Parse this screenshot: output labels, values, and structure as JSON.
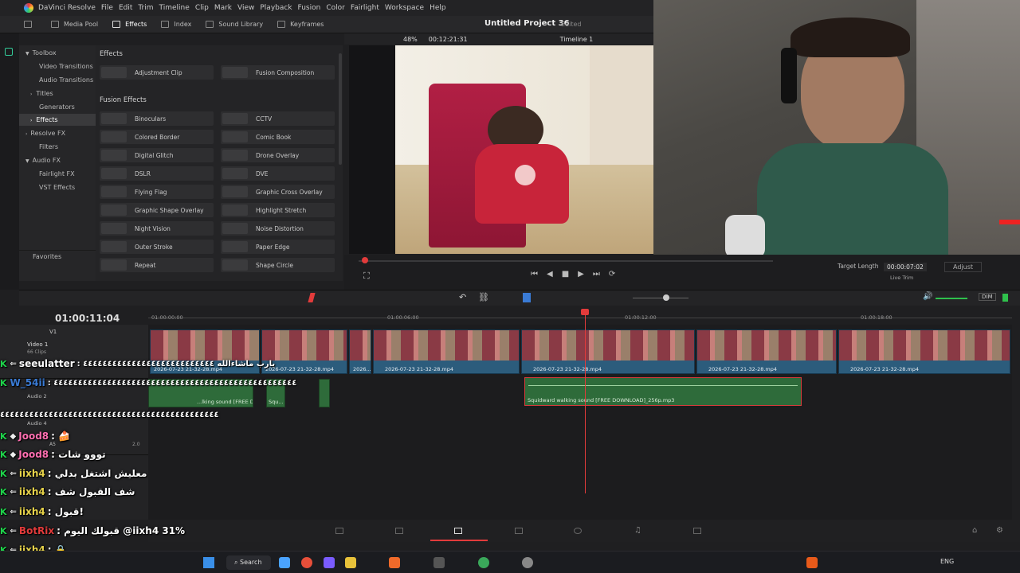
{
  "menu": {
    "app": "DaVinci Resolve",
    "items": [
      "File",
      "Edit",
      "Trim",
      "Timeline",
      "Clip",
      "Mark",
      "View",
      "Playback",
      "Fusion",
      "Color",
      "Fairlight",
      "Workspace",
      "Help"
    ]
  },
  "toolbar": {
    "media_pool": "Media Pool",
    "effects": "Effects",
    "index": "Index",
    "sound_library": "Sound Library",
    "keyframes": "Keyframes"
  },
  "project": {
    "title": "Untitled Project 36",
    "status": "Edited"
  },
  "viewer": {
    "zoom": "48%",
    "timecode": "00:12:21:31",
    "timeline_name": "Timeline 1"
  },
  "sidebar": {
    "items": [
      "Toolbox",
      "Video Transitions",
      "Audio Transitions",
      "Titles",
      "Generators",
      "Effects",
      "Resolve FX",
      "Filters",
      "Audio FX",
      "Fairlight FX",
      "VST Effects",
      "Favorites"
    ]
  },
  "effects": {
    "section1": "Effects",
    "section1_items": [
      "Adjustment Clip",
      "Fusion Composition"
    ],
    "section2": "Fusion Effects",
    "section2_items": [
      "Binoculars",
      "CCTV",
      "Colored Border",
      "Comic Book",
      "Digital Glitch",
      "Drone Overlay",
      "DSLR",
      "DVE",
      "Flying Flag",
      "Graphic Cross Overlay",
      "Graphic Shape Overlay",
      "Highlight Stretch",
      "Night Vision",
      "Noise Distortion",
      "Outer Stroke",
      "Paper Edge",
      "Repeat",
      "Shape Circle"
    ]
  },
  "transport": {
    "target_length_label": "Target Length",
    "target_length": "00:00:07:02",
    "live_trim": "Live Trim",
    "adjust": "Adjust",
    "dim": "DIM"
  },
  "timeline": {
    "current_timecode": "01:00:11:04",
    "ruler": [
      "01:00:00:00",
      "01:00:06:00",
      "01:00:12:00",
      "01:00:18:00"
    ],
    "video_track": {
      "name": "Video 1",
      "count": "66 Clips",
      "id": "V1"
    },
    "video_clips": [
      "2026-07-23 21-32-28.mp4",
      "2026-07-23 21-32-28.mp4",
      "2026...",
      "2026-07-23 21-32-28.mp4",
      "2026-07-23 21-32-28.mp4",
      "2026-07-23 21-32-28.mp4",
      "2026-07-23 21-32-28.mp4"
    ],
    "audio_track_2": "Audio 2",
    "audio_track_4": "Audio 4",
    "audio_track_4_id": "A5",
    "audio_level": "2.0",
    "audio_clips": [
      "...lking sound [FREE DOW...",
      "Squ...",
      "Squidward walking sound [FREE DOWNLOAD]_256p.mp3"
    ]
  },
  "chat": [
    {
      "user": "seeulatter",
      "msg": "يارب ماشاءالله ٤٤٤٤٤٤٤٤٤٤٤٤٤٤٤٤٤٤٤٤٤٤٤٤٤٤٤",
      "color": "#ffffff"
    },
    {
      "user": "W_54ii",
      "msg": "٤٤٤٤٤٤٤٤٤٤٤٤٤٤٤٤٤٤٤٤٤٤٤٤٤٤٤٤٤٤٤٤٤٤٤٤٤٤٤٤٤٤٤٤٤٤٤٤٤٤",
      "color": "#3a7bd5"
    },
    {
      "user": "",
      "msg": "٤٤٤٤٤٤٤٤٤٤٤٤٤٤٤٤٤٤٤٤٤٤٤٤٤٤٤٤٤٤٤٤٤٤٤٤٤٤٤٤٤٤٤٤٤",
      "color": "#ffffff"
    },
    {
      "user": "Jood8",
      "msg": "",
      "color": "#ff6fb1"
    },
    {
      "user": "Jood8",
      "msg": "تووو شات",
      "color": "#ff6fb1"
    },
    {
      "user": "iixh4",
      "msg": "معليش اشتغل بدلي",
      "color": "#e6d24a"
    },
    {
      "user": "iixh4",
      "msg": "شف القبول شف",
      "color": "#e6d24a"
    },
    {
      "user": "iixh4",
      "msg": "قبول!",
      "color": "#e6d24a"
    },
    {
      "user": "BotRix",
      "msg": "قبولك اليوم @iixh4 31%",
      "color": "#e23b3b"
    },
    {
      "user": "iixh4",
      "msg": "",
      "color": "#e6d24a"
    }
  ],
  "taskbar": {
    "search": "Search",
    "lang": "ENG"
  },
  "colors": {
    "accent_red": "#e23b3b",
    "video_clip": "#2c5c7c",
    "audio_clip": "#2e6b3a",
    "chat_green": "#1fd34b"
  }
}
